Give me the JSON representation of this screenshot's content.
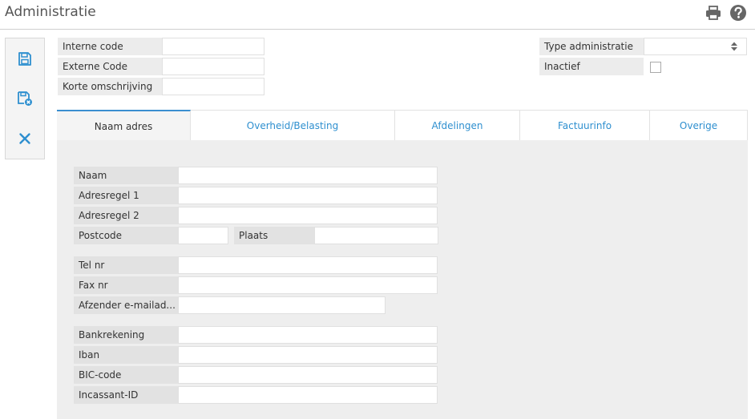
{
  "header": {
    "title": "Administratie",
    "print_icon": "print-icon",
    "help_icon": "help-icon"
  },
  "toolbar": {
    "save_icon": "save-icon",
    "save_close_icon": "save-and-close-icon",
    "cancel_icon": "close-icon"
  },
  "top_form": {
    "interne_code": {
      "label": "Interne code",
      "value": ""
    },
    "externe_code": {
      "label": "Externe Code",
      "value": ""
    },
    "korte_omschrijving": {
      "label": "Korte omschrijving",
      "value": ""
    },
    "type_administratie": {
      "label": "Type administratie",
      "value": ""
    },
    "inactief": {
      "label": "Inactief",
      "checked": false
    }
  },
  "tabs": [
    {
      "label": "Naam adres",
      "active": true
    },
    {
      "label": "Overheid/Belasting",
      "active": false
    },
    {
      "label": "Afdelingen",
      "active": false
    },
    {
      "label": "Factuurinfo",
      "active": false
    },
    {
      "label": "Overige",
      "active": false
    }
  ],
  "address_form": {
    "naam": {
      "label": "Naam",
      "value": ""
    },
    "adresregel1": {
      "label": "Adresregel 1",
      "value": ""
    },
    "adresregel2": {
      "label": "Adresregel 2",
      "value": ""
    },
    "postcode": {
      "label": "Postcode",
      "value": ""
    },
    "plaats": {
      "label": "Plaats",
      "value": ""
    },
    "tel_nr": {
      "label": "Tel nr",
      "value": ""
    },
    "fax_nr": {
      "label": "Fax nr",
      "value": ""
    },
    "afzender_email": {
      "label": "Afzender e-mailad...",
      "value": ""
    },
    "bankrekening": {
      "label": "Bankrekening",
      "value": ""
    },
    "iban": {
      "label": "Iban",
      "value": ""
    },
    "bic_code": {
      "label": "BIC-code",
      "value": ""
    },
    "incassant_id": {
      "label": "Incassant-ID",
      "value": ""
    }
  },
  "colors": {
    "accent": "#2e8fcf",
    "icon_gray": "#666666",
    "panel_bg": "#eeeeee"
  }
}
